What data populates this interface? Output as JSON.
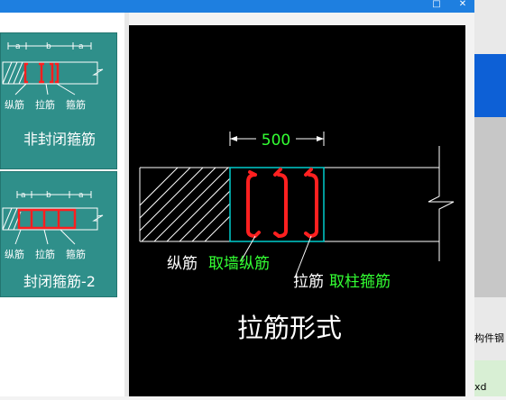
{
  "window": {
    "maximize_glyph": "□",
    "close_glyph": "✕"
  },
  "options": [
    {
      "dim_labels": [
        "a",
        "b",
        "a"
      ],
      "part_labels": [
        "纵筋",
        "拉筋",
        "箍筋"
      ],
      "title": "非封闭箍筋"
    },
    {
      "dim_labels": [
        "a",
        "b",
        "a"
      ],
      "part_labels": [
        "纵筋",
        "拉筋",
        "箍筋"
      ],
      "title": "封闭箍筋-2"
    }
  ],
  "preview": {
    "dimension": "500",
    "longitudinal_label": "纵筋",
    "longitudinal_source": "取墙纵筋",
    "tie_label": "拉筋",
    "tie_source": "取柱箍筋",
    "caption": "拉筋形式"
  },
  "right_panel": {
    "component_label": "构件钢",
    "bottom_text": "xd"
  },
  "colors": {
    "titlebar": "#1e7fe0",
    "card": "#2f8f8a",
    "canvas": "#000000",
    "rebar_red": "#ff2020",
    "dim_green": "#33ff33",
    "cyan_outline": "#00cccc"
  }
}
